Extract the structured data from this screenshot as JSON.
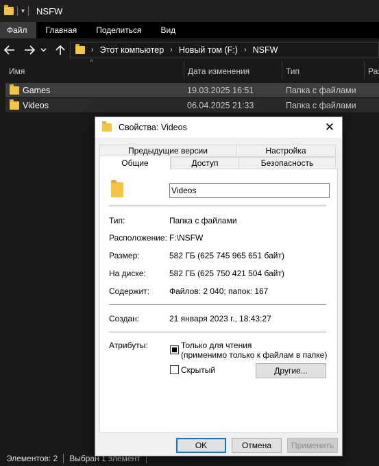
{
  "window": {
    "title": "NSFW"
  },
  "ribbon": {
    "tabs": [
      "Файл",
      "Главная",
      "Поделиться",
      "Вид"
    ]
  },
  "address": {
    "crumbs": [
      "Этот компьютер",
      "Новый том (F:)",
      "NSFW"
    ]
  },
  "columns": {
    "name": "Имя",
    "date": "Дата изменения",
    "type": "Тип",
    "size": "Раз"
  },
  "files": [
    {
      "name": "Games",
      "date": "19.03.2025 16:51",
      "type": "Папка с файлами"
    },
    {
      "name": "Videos",
      "date": "06.04.2025 21:33",
      "type": "Папка с файлами"
    }
  ],
  "status": {
    "count": "Элементов: 2",
    "selected": "Выбран 1 элемент"
  },
  "dialog": {
    "title": "Свойства: Videos",
    "tabs_top": [
      "Предыдущие версии",
      "Настройка"
    ],
    "tabs_bottom": [
      "Общие",
      "Доступ",
      "Безопасность"
    ],
    "name_value": "Videos",
    "type_label": "Тип:",
    "type_value": "Папка с файлами",
    "location_label": "Расположение:",
    "location_value": "F:\\NSFW",
    "size_label": "Размер:",
    "size_value": "582 ГБ (625 745 965 651 байт)",
    "ondisk_label": "На диске:",
    "ondisk_value": "582 ГБ (625 750 421 504 байт)",
    "contains_label": "Содержит:",
    "contains_value": "Файлов: 2 040; папок: 167",
    "created_label": "Создан:",
    "created_value": "21 января 2023 г., 18:43:27",
    "attributes_label": "Атрибуты:",
    "readonly_line1": "Только для чтения",
    "readonly_line2": "(применимо только к файлам в папке)",
    "hidden_label": "Скрытый",
    "other_button": "Другие...",
    "ok_button": "OK",
    "cancel_button": "Отмена",
    "apply_button": "Применить"
  },
  "icons": [
    "folder-icon",
    "back-arrow-icon",
    "forward-arrow-icon",
    "recent-chevron-icon",
    "up-arrow-icon",
    "close-icon",
    "sort-up-icon"
  ],
  "colors": {
    "explorer_bg": "#191919",
    "selection": "#3e3e3e",
    "dialog_bg": "#f0f0f0",
    "accent": "#0078d7"
  }
}
